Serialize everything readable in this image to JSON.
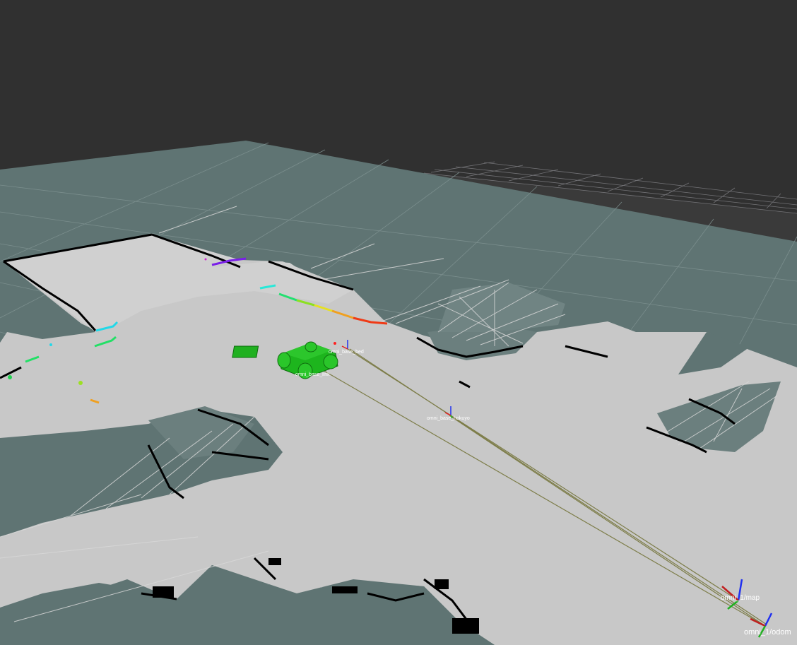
{
  "viewport": {
    "background_color": "#303030",
    "grid_color": "#a0a0a4",
    "free_space_color": "#c8c8c8",
    "unknown_space_color": "#5f7473",
    "occupied_color": "#000000",
    "robot_color": "#1db51d"
  },
  "frames": {
    "base_frame": "omni_base_bed",
    "link_frame": "omni_base_link",
    "hokuyo_frame": "omni_base_hokuyo",
    "map_frame": "omni_1/map",
    "odom_frame": "omni_1/odom"
  },
  "icons": {
    "robot_model": "robot-model-icon",
    "axes": "tf-axes-icon",
    "laser_scan": "laser-scan-icon"
  }
}
